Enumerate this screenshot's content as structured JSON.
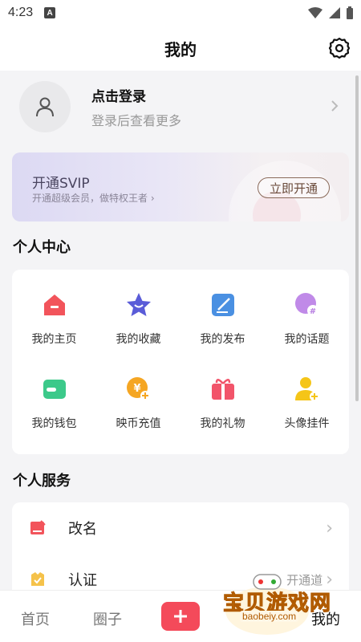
{
  "status_bar": {
    "time": "4:23",
    "badge": "A"
  },
  "header": {
    "title": "我的"
  },
  "login": {
    "title": "点击登录",
    "subtitle": "登录后查看更多"
  },
  "vip": {
    "title": "开通SVIP",
    "subtitle": "开通超级会员，做特权王者",
    "button": "立即开通"
  },
  "personal_center": {
    "title": "个人中心",
    "items": [
      {
        "label": "我的主页",
        "icon": "home-icon",
        "color": "#f2545b"
      },
      {
        "label": "我的收藏",
        "icon": "star-icon",
        "color": "#5a5cd8"
      },
      {
        "label": "我的发布",
        "icon": "edit-icon",
        "color": "#4a90e2"
      },
      {
        "label": "我的话题",
        "icon": "topic-icon",
        "color": "#b57be0"
      },
      {
        "label": "我的钱包",
        "icon": "wallet-icon",
        "color": "#3cc98a"
      },
      {
        "label": "映币充值",
        "icon": "coin-recharge-icon",
        "color": "#f5a623"
      },
      {
        "label": "我的礼物",
        "icon": "gift-icon",
        "color": "#f2546a"
      },
      {
        "label": "头像挂件",
        "icon": "avatar-pendant-icon",
        "color": "#f5c518"
      }
    ]
  },
  "personal_service": {
    "title": "个人服务",
    "items": [
      {
        "label": "改名",
        "icon": "rename-icon",
        "color": "#f2545b",
        "right": ""
      },
      {
        "label": "认证",
        "icon": "certify-icon",
        "color": "#f5c24a",
        "right": "开通道"
      }
    ]
  },
  "tabbar": {
    "home": "首页",
    "circle": "圈子",
    "mine": "我的"
  },
  "watermark": {
    "text": "宝贝游戏网",
    "url": "baobeiy.com"
  }
}
